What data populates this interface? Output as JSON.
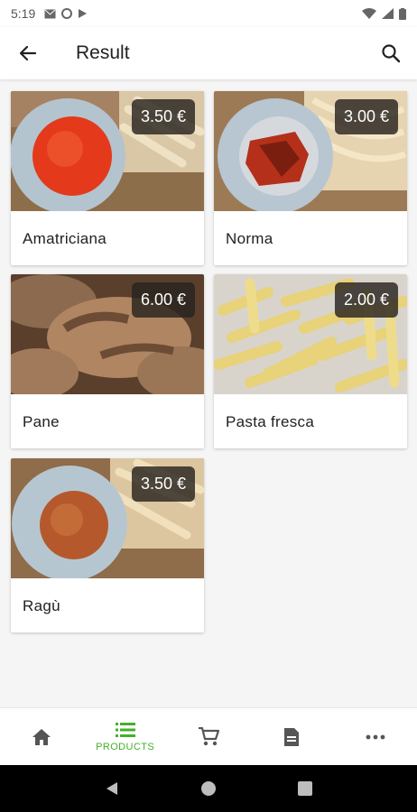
{
  "status_bar": {
    "time": "5:19"
  },
  "app_bar": {
    "title": "Result"
  },
  "products": [
    {
      "name": "Amatriciana",
      "price": "3.50 €"
    },
    {
      "name": "Norma",
      "price": "3.00 €"
    },
    {
      "name": "Pane",
      "price": "6.00 €"
    },
    {
      "name": "Pasta fresca",
      "price": "2.00 €"
    },
    {
      "name": "Ragù",
      "price": "3.50 €"
    }
  ],
  "bottom_nav": {
    "items": [
      {
        "icon": "home-icon",
        "label": ""
      },
      {
        "icon": "list-icon",
        "label": "PRODUCTS",
        "active": true
      },
      {
        "icon": "cart-icon",
        "label": ""
      },
      {
        "icon": "document-icon",
        "label": ""
      },
      {
        "icon": "more-icon",
        "label": ""
      }
    ]
  },
  "colors": {
    "accent": "#43b02a",
    "app_bar": "#ffffff",
    "background": "#f5f5f5"
  }
}
